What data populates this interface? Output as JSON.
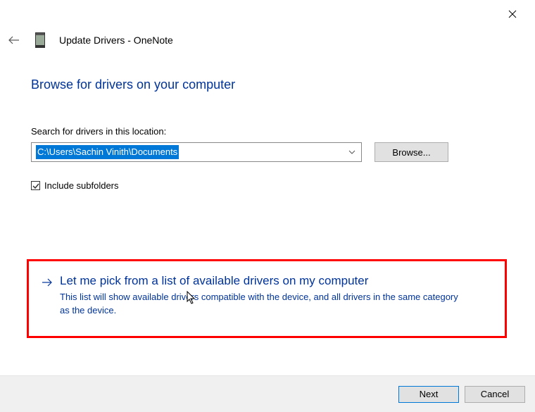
{
  "window_title": "Update Drivers - OneNote",
  "heading": "Browse for drivers on your computer",
  "search_label": "Search for drivers in this location:",
  "location_value": "C:\\Users\\Sachin Vinith\\Documents",
  "browse_label": "Browse...",
  "include_subfolders_label": "Include subfolders",
  "include_subfolders_checked": true,
  "option": {
    "title": "Let me pick from a list of available drivers on my computer",
    "desc": "This list will show available drivers compatible with the device, and all drivers in the same category as the device."
  },
  "footer": {
    "next": "Next",
    "cancel": "Cancel"
  }
}
